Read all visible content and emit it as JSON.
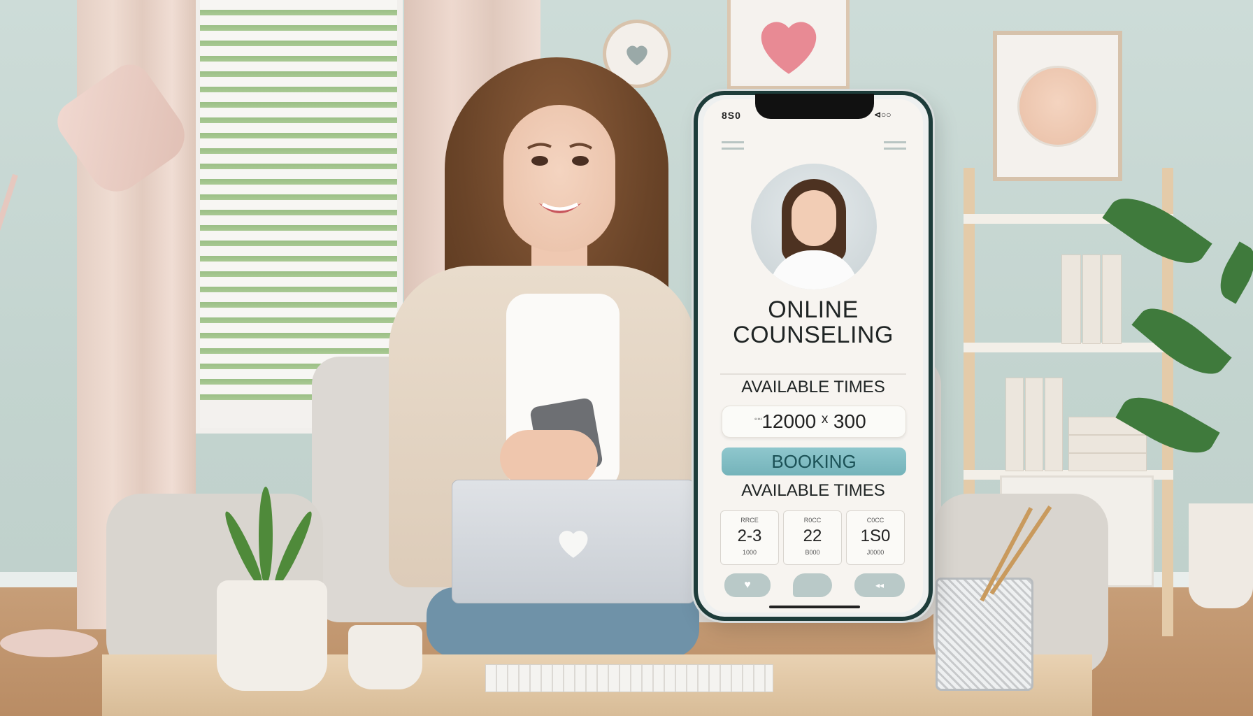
{
  "phone_app": {
    "status_bar": {
      "time": "8S0",
      "icons": "⊲○○"
    },
    "title_line1": "ONLINE",
    "title_line2": "COUNSELING",
    "available_heading_1": "AVAILABLE TIMES",
    "time_display": "12000 ˣ 300",
    "time_display_mini": "ʻʻʻʻʻ",
    "booking_button": "BOOKING",
    "available_heading_2": "AVAILABLE TIMES",
    "slots": [
      {
        "top": "RRCE",
        "value": "2-3",
        "bottom": "1000"
      },
      {
        "top": "R0CC",
        "value": "22",
        "bottom": "B000"
      },
      {
        "top": "C0CC",
        "value": "1S0",
        "bottom": "J0000"
      }
    ],
    "nav": [
      {
        "icon": "heart-icon",
        "glyph": "♥"
      },
      {
        "icon": "chat-bubble-icon",
        "glyph": ""
      },
      {
        "icon": "more-icon",
        "glyph": "◂◂"
      }
    ],
    "colors": {
      "accent": "#7ab8bf",
      "frame": "#1d3c3a"
    }
  },
  "scene": {
    "description_icons": [
      "heart-icon",
      "clock-icon"
    ],
    "colors": {
      "wall": "#c9d8d4",
      "heart": "#e88a94"
    }
  }
}
